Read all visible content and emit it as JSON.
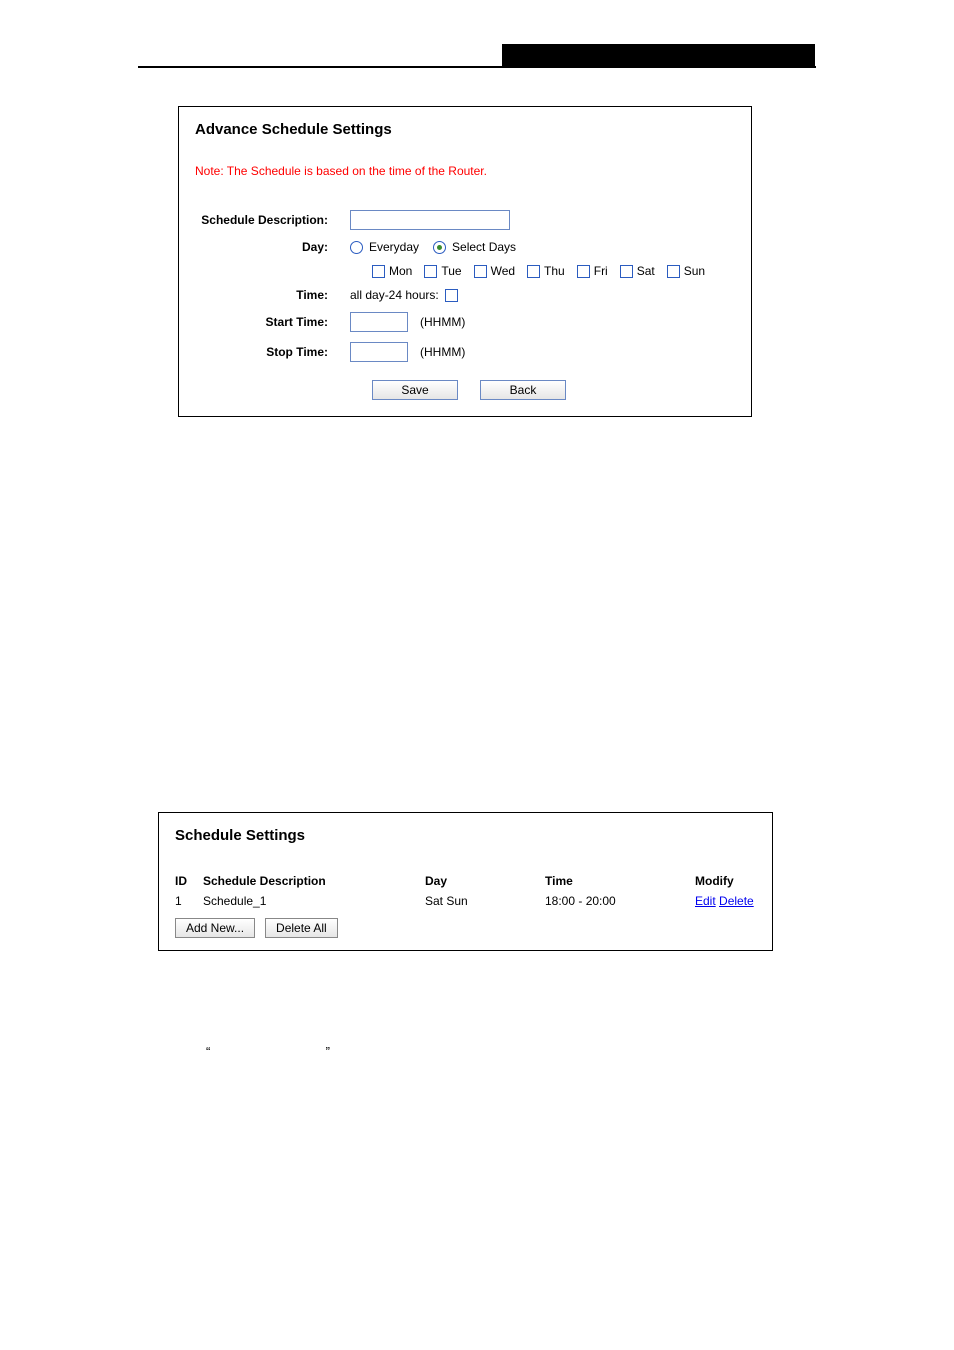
{
  "form": {
    "title": "Advance Schedule Settings",
    "note": "Note: The Schedule is based on the time of the Router.",
    "labels": {
      "schedule_description": "Schedule Description:",
      "day": "Day:",
      "time": "Time:",
      "start_time": "Start Time:",
      "stop_time": "Stop Time:"
    },
    "radio": {
      "everyday": "Everyday",
      "select_days": "Select Days",
      "selected": "select_days"
    },
    "days": {
      "mon": "Mon",
      "tue": "Tue",
      "wed": "Wed",
      "thu": "Thu",
      "fri": "Fri",
      "sat": "Sat",
      "sun": "Sun"
    },
    "time_text": "all day-24 hours:",
    "hint": "(HHMM)",
    "values": {
      "schedule_description": "",
      "start_time": "",
      "stop_time": ""
    },
    "buttons": {
      "save": "Save",
      "back": "Back"
    }
  },
  "list": {
    "title": "Schedule Settings",
    "headers": {
      "id": "ID",
      "desc": "Schedule Description",
      "day": "Day",
      "time": "Time",
      "modify": "Modify"
    },
    "rows": [
      {
        "id": "1",
        "desc": "Schedule_1",
        "day": "Sat Sun",
        "time": "18:00 - 20:00",
        "edit": "Edit",
        "delete": "Delete"
      }
    ],
    "buttons": {
      "add_new": "Add New...",
      "delete_all": "Delete All"
    }
  },
  "quotes": {
    "open": "“",
    "close": "”"
  }
}
